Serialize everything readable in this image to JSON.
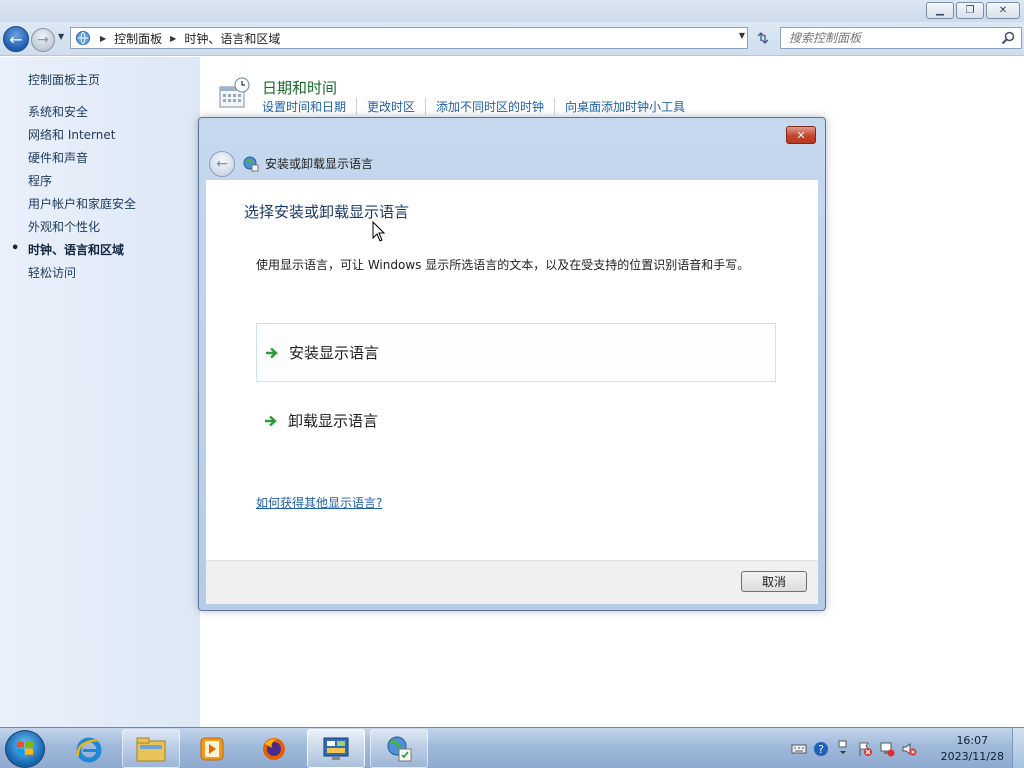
{
  "window": {
    "minimize_glyph": "▁",
    "restore_glyph": "❐",
    "close_glyph": "✕"
  },
  "navbar": {
    "breadcrumbs": [
      "控制面板",
      "时钟、语言和区域"
    ],
    "search_placeholder": "搜索控制面板"
  },
  "sidebar": {
    "home": "控制面板主页",
    "items": [
      {
        "label": "系统和安全",
        "active": false
      },
      {
        "label": "网络和 Internet",
        "active": false
      },
      {
        "label": "硬件和声音",
        "active": false
      },
      {
        "label": "程序",
        "active": false
      },
      {
        "label": "用户帐户和家庭安全",
        "active": false
      },
      {
        "label": "外观和个性化",
        "active": false
      },
      {
        "label": "时钟、语言和区域",
        "active": true
      },
      {
        "label": "轻松访问",
        "active": false
      }
    ]
  },
  "main": {
    "category": {
      "title": "日期和时间",
      "icon": "calendar-clock-icon",
      "links": [
        "设置时间和日期",
        "更改时区",
        "添加不同时区的时钟",
        "向桌面添加时钟小工具"
      ]
    }
  },
  "dialog": {
    "title": "安装或卸载显示语言",
    "close_glyph": "✕",
    "heading": "选择安装或卸载显示语言",
    "description": "使用显示语言，可让 Windows 显示所选语言的文本，以及在受支持的位置识别语音和手写。",
    "options": [
      {
        "label": "安装显示语言",
        "icon": "green-arrow-icon"
      },
      {
        "label": "卸载显示语言",
        "icon": "green-arrow-icon"
      }
    ],
    "help_link": "如何获得其他显示语言?",
    "cancel_label": "取消"
  },
  "taskbar": {
    "apps": [
      "start-orb",
      "internet-explorer",
      "windows-explorer",
      "media-player",
      "firefox",
      "control-panel",
      "language-settings"
    ],
    "clock_time": "16:07",
    "clock_date": "2023/11/28"
  },
  "colors": {
    "accent_link": "#1f5fa8",
    "category_title": "#1b6b2a",
    "dialog_close": "#c4452d"
  }
}
